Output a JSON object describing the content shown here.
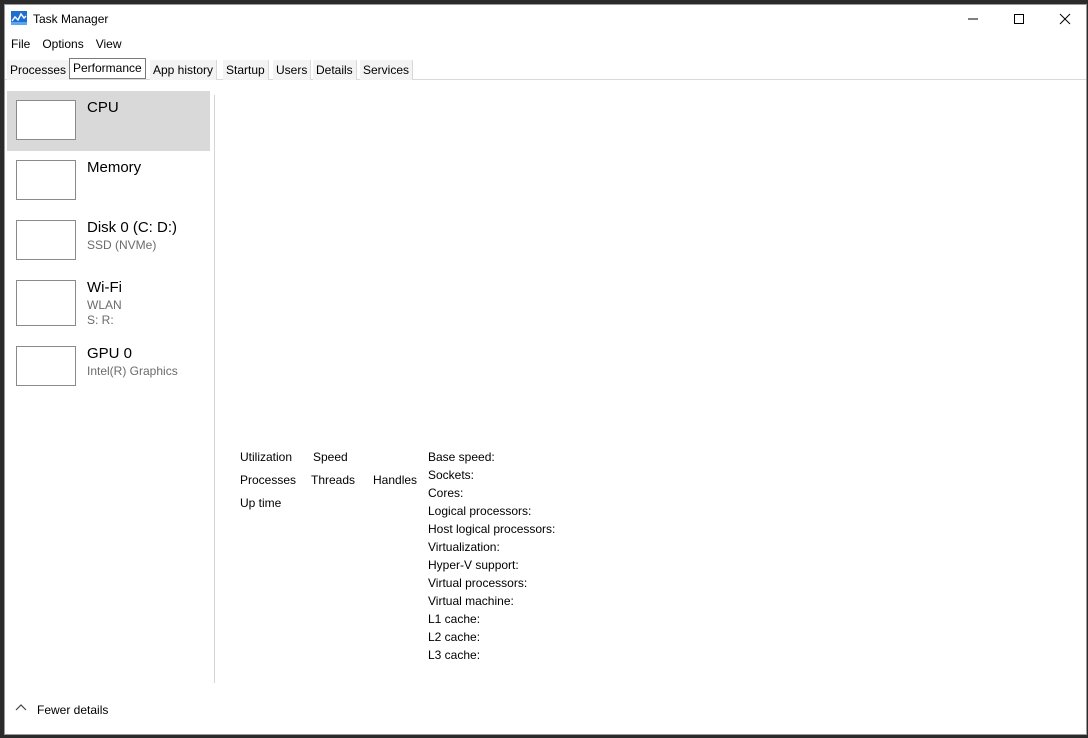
{
  "window": {
    "title": "Task Manager",
    "accent": "#0067c0"
  },
  "menu": [
    "File",
    "Options",
    "View"
  ],
  "tabs": [
    {
      "label": "Processes",
      "active": false
    },
    {
      "label": "Performance",
      "active": true
    },
    {
      "label": "App history",
      "active": false
    },
    {
      "label": "Startup",
      "active": false
    },
    {
      "label": "Users",
      "active": false
    },
    {
      "label": "Details",
      "active": false
    },
    {
      "label": "Services",
      "active": false
    }
  ],
  "perf_items": [
    {
      "name": "CPU",
      "sub1": "",
      "sub2": "",
      "selected": true
    },
    {
      "name": "Memory",
      "sub1": "",
      "sub2": "",
      "selected": false
    },
    {
      "name": "Disk 0 (C: D:)",
      "sub1": "SSD (NVMe)",
      "sub2": "",
      "selected": false
    },
    {
      "name": "Wi-Fi",
      "sub1": "WLAN",
      "sub2": "S:  R:",
      "selected": false
    },
    {
      "name": "GPU 0",
      "sub1": "Intel(R) Graphics",
      "sub2": "",
      "selected": false
    }
  ],
  "stats": {
    "utilization": "Utilization",
    "speed": "Speed",
    "processes": "Processes",
    "threads": "Threads",
    "handles": "Handles",
    "uptime": "Up time"
  },
  "specs": [
    "Base speed:",
    "Sockets:",
    "Cores:",
    "Logical processors:",
    "Host logical processors:",
    "Virtualization:",
    "Hyper-V support:",
    "Virtual processors:",
    "Virtual machine:",
    "L1 cache:",
    "L2 cache:",
    "L3 cache:"
  ],
  "footer": {
    "fewer_details": "Fewer details",
    "icon": "chevron-up-icon"
  }
}
